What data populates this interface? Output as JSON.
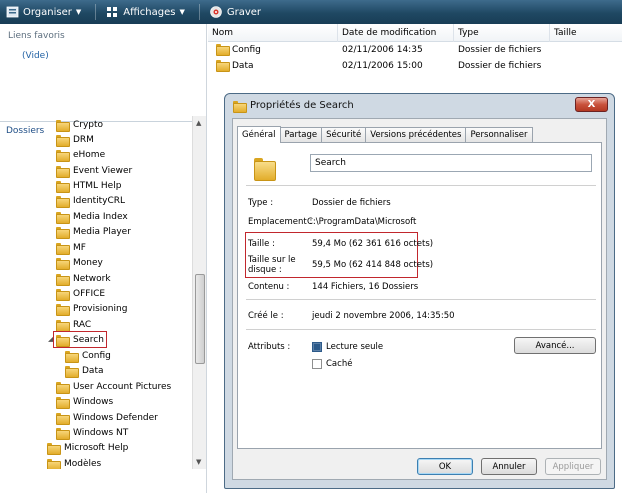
{
  "toolbar": {
    "organize_label": "Organiser",
    "views_label": "Affichages",
    "burn_label": "Graver"
  },
  "nav": {
    "favorites_title": "Liens favoris",
    "favorites_empty": "(Vide)",
    "folders_title": "Dossiers",
    "tree": [
      "Crypto",
      "DRM",
      "eHome",
      "Event Viewer",
      "HTML Help",
      "IdentityCRL",
      "Media Index",
      "Media Player",
      "MF",
      "Money",
      "Network",
      "OFFICE",
      "Provisioning",
      "RAC",
      "Search",
      "Config",
      "Data",
      "User Account Pictures",
      "Windows",
      "Windows Defender",
      "Windows NT",
      "Microsoft Help",
      "Modèles"
    ]
  },
  "list": {
    "columns": [
      "Nom",
      "Date de modification",
      "Type",
      "Taille"
    ],
    "rows": [
      {
        "name": "Config",
        "date": "02/11/2006 14:35",
        "type": "Dossier de fichiers",
        "size": ""
      },
      {
        "name": "Data",
        "date": "02/11/2006 15:00",
        "type": "Dossier de fichiers",
        "size": ""
      }
    ]
  },
  "dialog": {
    "title": "Propriétés de Search",
    "close_label": "X",
    "tabs": [
      "Général",
      "Partage",
      "Sécurité",
      "Versions précédentes",
      "Personnaliser"
    ],
    "active_tab": "Général",
    "folder_name": "Search",
    "type_label": "Type :",
    "type_value": "Dossier de fichiers",
    "location_label": "Emplacement :",
    "location_value": "C:\\ProgramData\\Microsoft",
    "size_label": "Taille :",
    "size_value": "59,4 Mo (62 361 616 octets)",
    "disk_size_label_1": "Taille sur le",
    "disk_size_label_2": "disque :",
    "disk_size_value": "59,5 Mo (62 414 848 octets)",
    "contents_label": "Contenu :",
    "contents_value": "144 Fichiers, 16 Dossiers",
    "created_label": "Créé le :",
    "created_value": "jeudi 2 novembre 2006, 14:35:50",
    "attributes_label": "Attributs :",
    "readonly_label": "Lecture seule",
    "readonly_checked": true,
    "hidden_label": "Caché",
    "hidden_checked": false,
    "advanced_label": "Avancé...",
    "ok_label": "OK",
    "cancel_label": "Annuler",
    "apply_label": "Appliquer"
  },
  "colors": {
    "highlight_box": "#c1272d",
    "toolbar": "#1f4863"
  }
}
